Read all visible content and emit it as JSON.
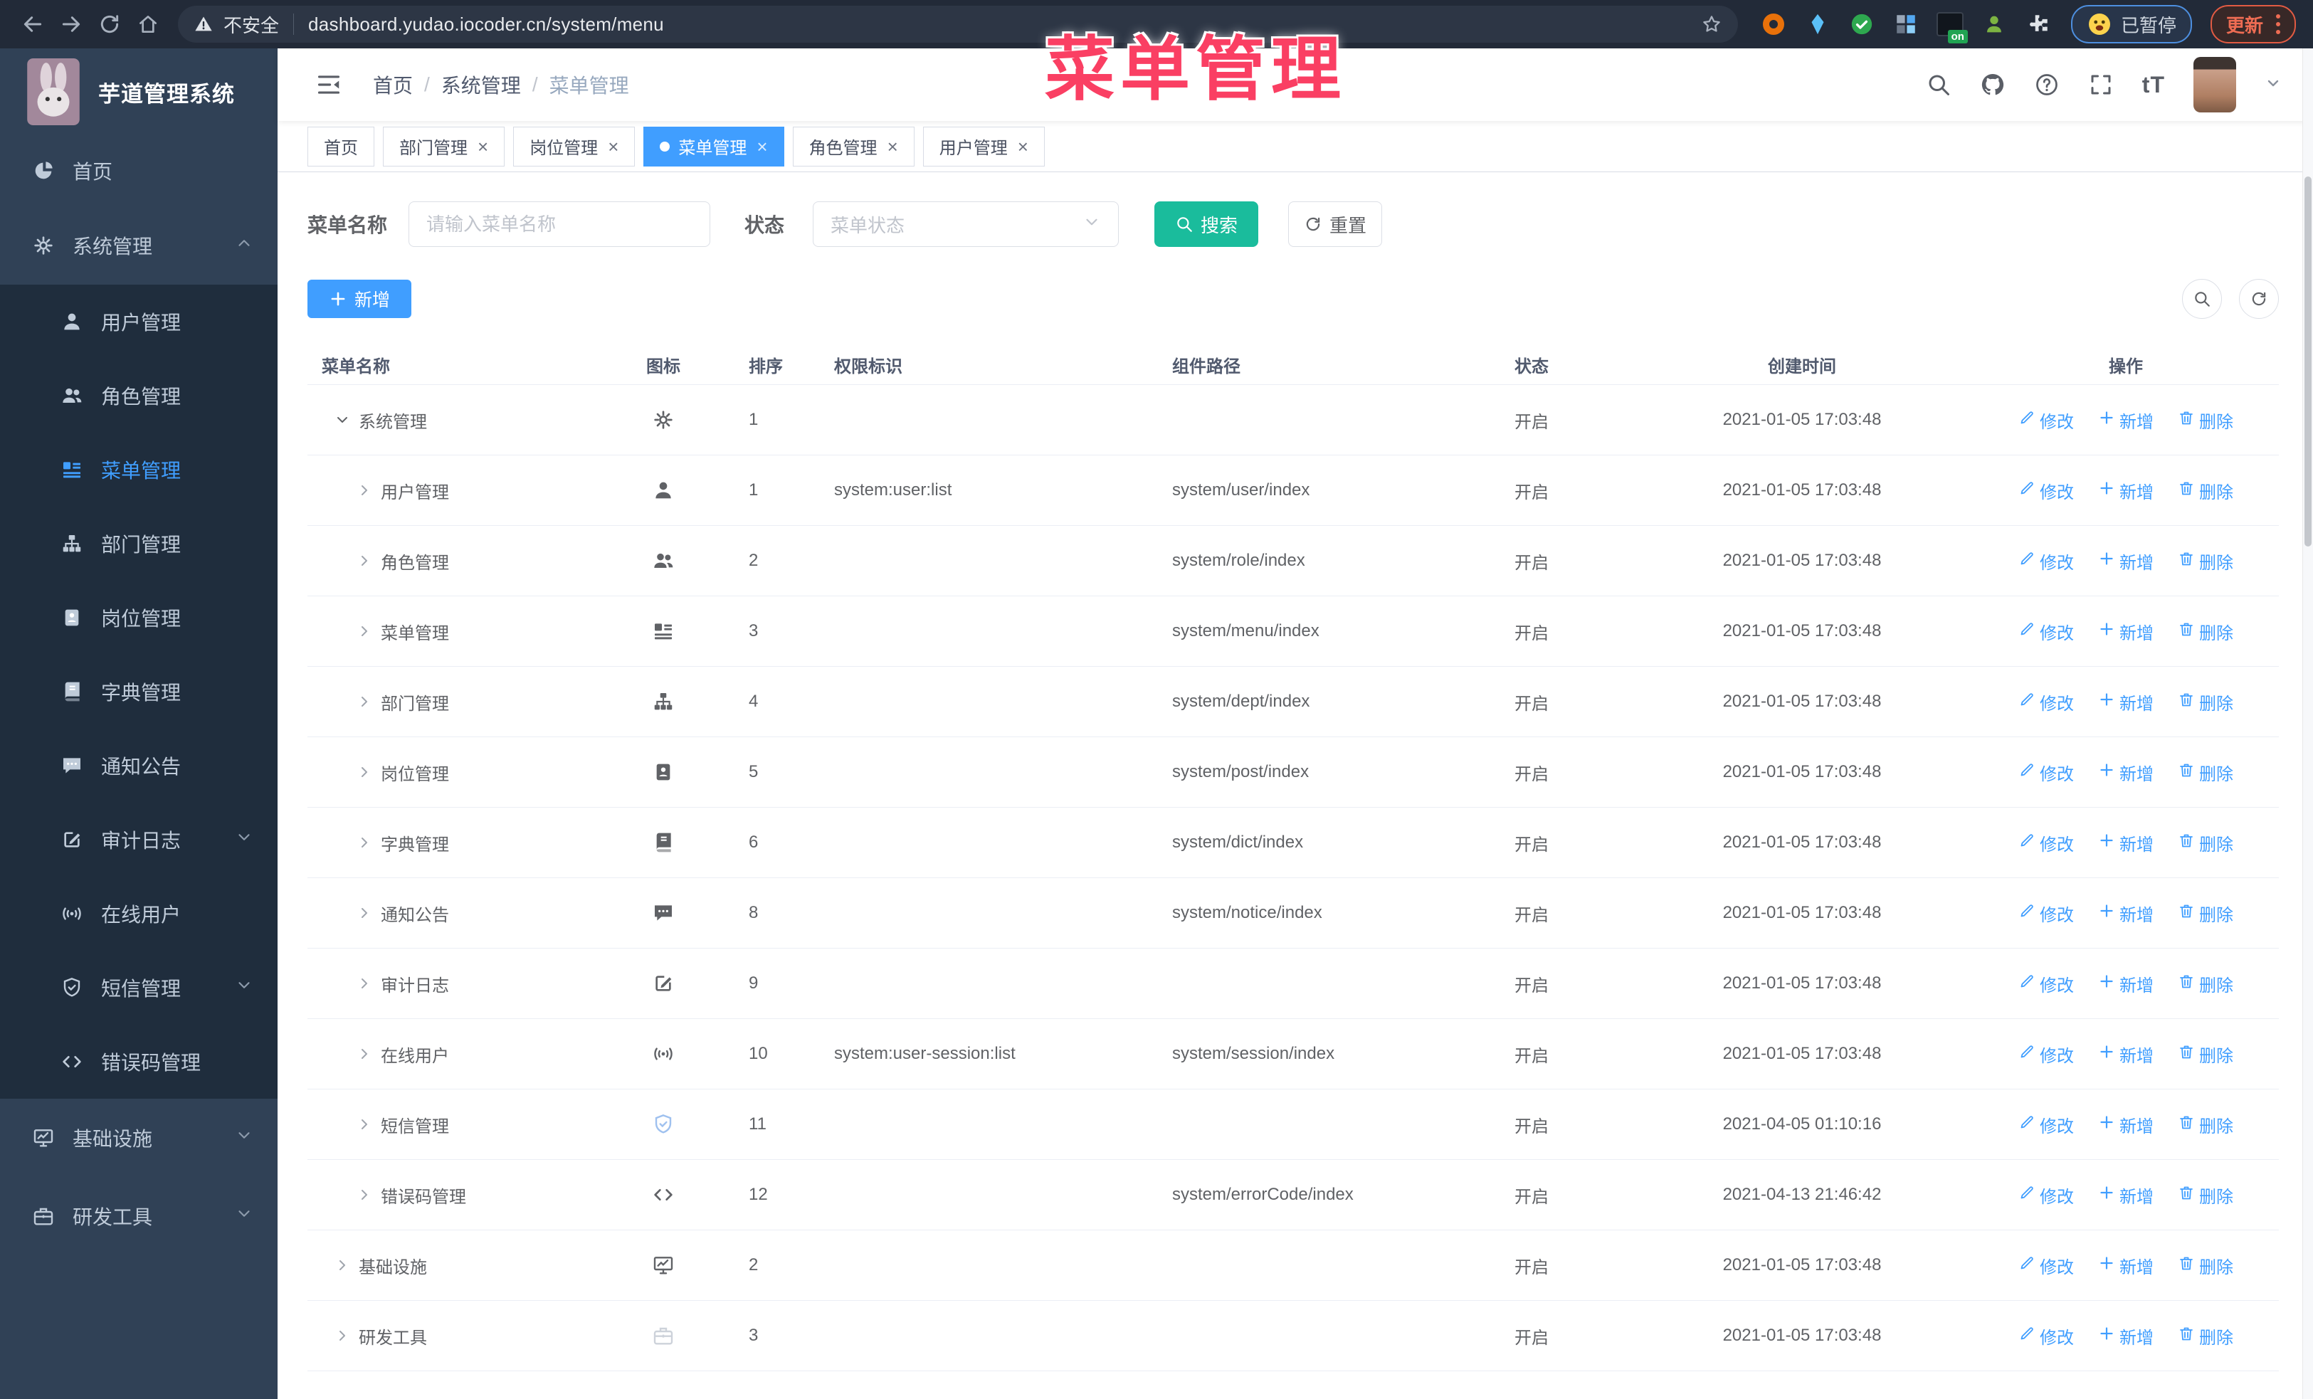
{
  "browser": {
    "security": "不安全",
    "url": "dashboard.yudao.iocoder.cn/system/menu",
    "paused": "已暂停",
    "update": "更新",
    "on_badge": "on"
  },
  "overlay": {
    "title": "菜单管理"
  },
  "colors": {
    "accent": "#409eff",
    "search_button": "#1abc9c",
    "overlay": "#fa3f63",
    "sidebar_bg": "#304156",
    "submenu_bg": "#1f2d3d"
  },
  "sidebar": {
    "title": "芋道管理系统",
    "items": [
      {
        "key": "home",
        "label": "首页",
        "icon": "dashboard",
        "level": 1
      },
      {
        "key": "system",
        "label": "系统管理",
        "icon": "gear",
        "level": 1,
        "expanded": true,
        "chevron": "up"
      },
      {
        "key": "user",
        "label": "用户管理",
        "icon": "user",
        "level": 2
      },
      {
        "key": "role",
        "label": "角色管理",
        "icon": "users",
        "level": 2
      },
      {
        "key": "menu",
        "label": "菜单管理",
        "icon": "menu",
        "level": 2,
        "active": true
      },
      {
        "key": "dept",
        "label": "部门管理",
        "icon": "tree",
        "level": 2
      },
      {
        "key": "post",
        "label": "岗位管理",
        "icon": "badge",
        "level": 2
      },
      {
        "key": "dict",
        "label": "字典管理",
        "icon": "dict",
        "level": 2
      },
      {
        "key": "notice",
        "label": "通知公告",
        "icon": "notice",
        "level": 2
      },
      {
        "key": "audit",
        "label": "审计日志",
        "icon": "audit",
        "level": 2,
        "chevron": "down"
      },
      {
        "key": "online",
        "label": "在线用户",
        "icon": "online",
        "level": 2
      },
      {
        "key": "sms",
        "label": "短信管理",
        "icon": "sms",
        "level": 2,
        "chevron": "down"
      },
      {
        "key": "errcode",
        "label": "错误码管理",
        "icon": "code",
        "level": 2
      },
      {
        "key": "infra",
        "label": "基础设施",
        "icon": "infra",
        "level": 1,
        "chevron": "down"
      },
      {
        "key": "tool",
        "label": "研发工具",
        "icon": "tool",
        "level": 1,
        "chevron": "down"
      }
    ]
  },
  "breadcrumb": [
    "首页",
    "系统管理",
    "菜单管理"
  ],
  "tabs": [
    {
      "label": "首页",
      "closable": false,
      "active": false
    },
    {
      "label": "部门管理",
      "closable": true,
      "active": false
    },
    {
      "label": "岗位管理",
      "closable": true,
      "active": false
    },
    {
      "label": "菜单管理",
      "closable": true,
      "active": true
    },
    {
      "label": "角色管理",
      "closable": true,
      "active": false
    },
    {
      "label": "用户管理",
      "closable": true,
      "active": false
    }
  ],
  "filters": {
    "name_label": "菜单名称",
    "name_placeholder": "请输入菜单名称",
    "status_label": "状态",
    "status_placeholder": "菜单状态",
    "search": "搜索",
    "reset": "重置"
  },
  "toolbar": {
    "add": "新增"
  },
  "table": {
    "columns": [
      "菜单名称",
      "图标",
      "排序",
      "权限标识",
      "组件路径",
      "状态",
      "创建时间",
      "操作"
    ],
    "actions": {
      "edit": "修改",
      "add": "新增",
      "delete": "删除"
    },
    "rows": [
      {
        "name": "系统管理",
        "icon": "gear",
        "level": 1,
        "expanded": true,
        "sort": "1",
        "perm": "",
        "path": "",
        "status": "开启",
        "time": "2021-01-05 17:03:48"
      },
      {
        "name": "用户管理",
        "icon": "user",
        "level": 2,
        "sort": "1",
        "perm": "system:user:list",
        "path": "system/user/index",
        "status": "开启",
        "time": "2021-01-05 17:03:48"
      },
      {
        "name": "角色管理",
        "icon": "users",
        "level": 2,
        "sort": "2",
        "perm": "",
        "path": "system/role/index",
        "status": "开启",
        "time": "2021-01-05 17:03:48"
      },
      {
        "name": "菜单管理",
        "icon": "menu",
        "level": 2,
        "sort": "3",
        "perm": "",
        "path": "system/menu/index",
        "status": "开启",
        "time": "2021-01-05 17:03:48"
      },
      {
        "name": "部门管理",
        "icon": "tree",
        "level": 2,
        "sort": "4",
        "perm": "",
        "path": "system/dept/index",
        "status": "开启",
        "time": "2021-01-05 17:03:48"
      },
      {
        "name": "岗位管理",
        "icon": "badge",
        "level": 2,
        "sort": "5",
        "perm": "",
        "path": "system/post/index",
        "status": "开启",
        "time": "2021-01-05 17:03:48"
      },
      {
        "name": "字典管理",
        "icon": "dict",
        "level": 2,
        "sort": "6",
        "perm": "",
        "path": "system/dict/index",
        "status": "开启",
        "time": "2021-01-05 17:03:48"
      },
      {
        "name": "通知公告",
        "icon": "notice",
        "level": 2,
        "sort": "8",
        "perm": "",
        "path": "system/notice/index",
        "status": "开启",
        "time": "2021-01-05 17:03:48"
      },
      {
        "name": "审计日志",
        "icon": "audit",
        "level": 2,
        "sort": "9",
        "perm": "",
        "path": "",
        "status": "开启",
        "time": "2021-01-05 17:03:48"
      },
      {
        "name": "在线用户",
        "icon": "online",
        "level": 2,
        "sort": "10",
        "perm": "system:user-session:list",
        "path": "system/session/index",
        "status": "开启",
        "time": "2021-01-05 17:03:48"
      },
      {
        "name": "短信管理",
        "icon": "sms",
        "level": 2,
        "icon_color": "#9fc1ef",
        "sort": "11",
        "perm": "",
        "path": "",
        "status": "开启",
        "time": "2021-04-05 01:10:16"
      },
      {
        "name": "错误码管理",
        "icon": "code",
        "level": 2,
        "sort": "12",
        "perm": "",
        "path": "system/errorCode/index",
        "status": "开启",
        "time": "2021-04-13 21:46:42"
      },
      {
        "name": "基础设施",
        "icon": "infra",
        "level": 1,
        "sort": "2",
        "perm": "",
        "path": "",
        "status": "开启",
        "time": "2021-01-05 17:03:48"
      },
      {
        "name": "研发工具",
        "icon": "tool",
        "level": 1,
        "icon_color": "#cdd2da",
        "sort": "3",
        "perm": "",
        "path": "",
        "status": "开启",
        "time": "2021-01-05 17:03:48"
      }
    ]
  }
}
